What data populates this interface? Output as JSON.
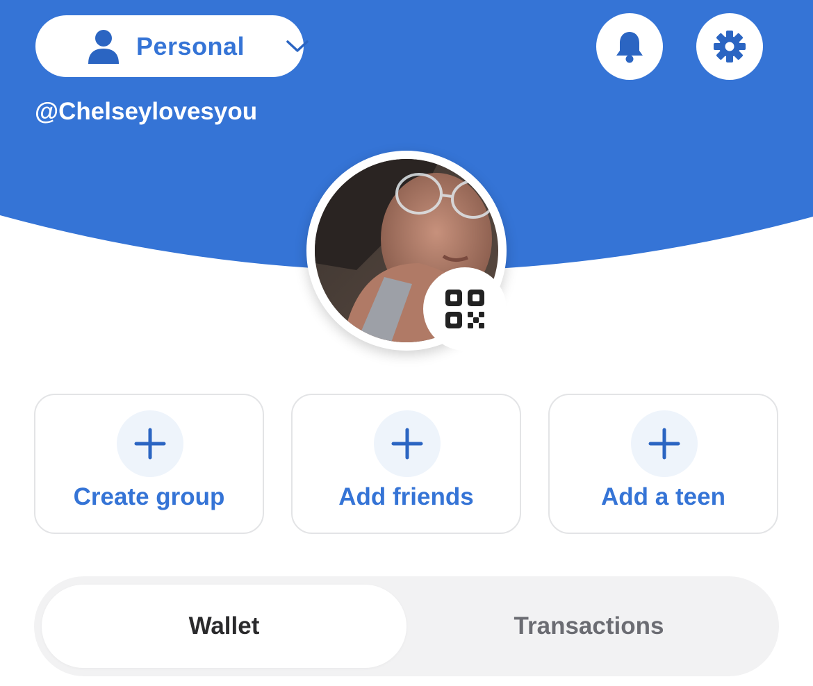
{
  "colors": {
    "brand_blue": "#3574d6",
    "icon_blue": "#2b65c2",
    "white": "#ffffff"
  },
  "header": {
    "account_switcher": {
      "label": "Personal",
      "icon": "person-icon",
      "chevron": "chevron-down-icon"
    },
    "notifications_icon": "bell-icon",
    "settings_icon": "gear-icon",
    "username": "@Chelseylovesyou"
  },
  "profile": {
    "avatar_alt": "profile photo",
    "qr_icon": "qr-code-icon"
  },
  "actions": [
    {
      "label": "Create group",
      "icon": "plus-icon"
    },
    {
      "label": "Add friends",
      "icon": "plus-icon"
    },
    {
      "label": "Add a teen",
      "icon": "plus-icon"
    }
  ],
  "tabs": [
    {
      "label": "Wallet",
      "selected": true
    },
    {
      "label": "Transactions",
      "selected": false
    }
  ]
}
